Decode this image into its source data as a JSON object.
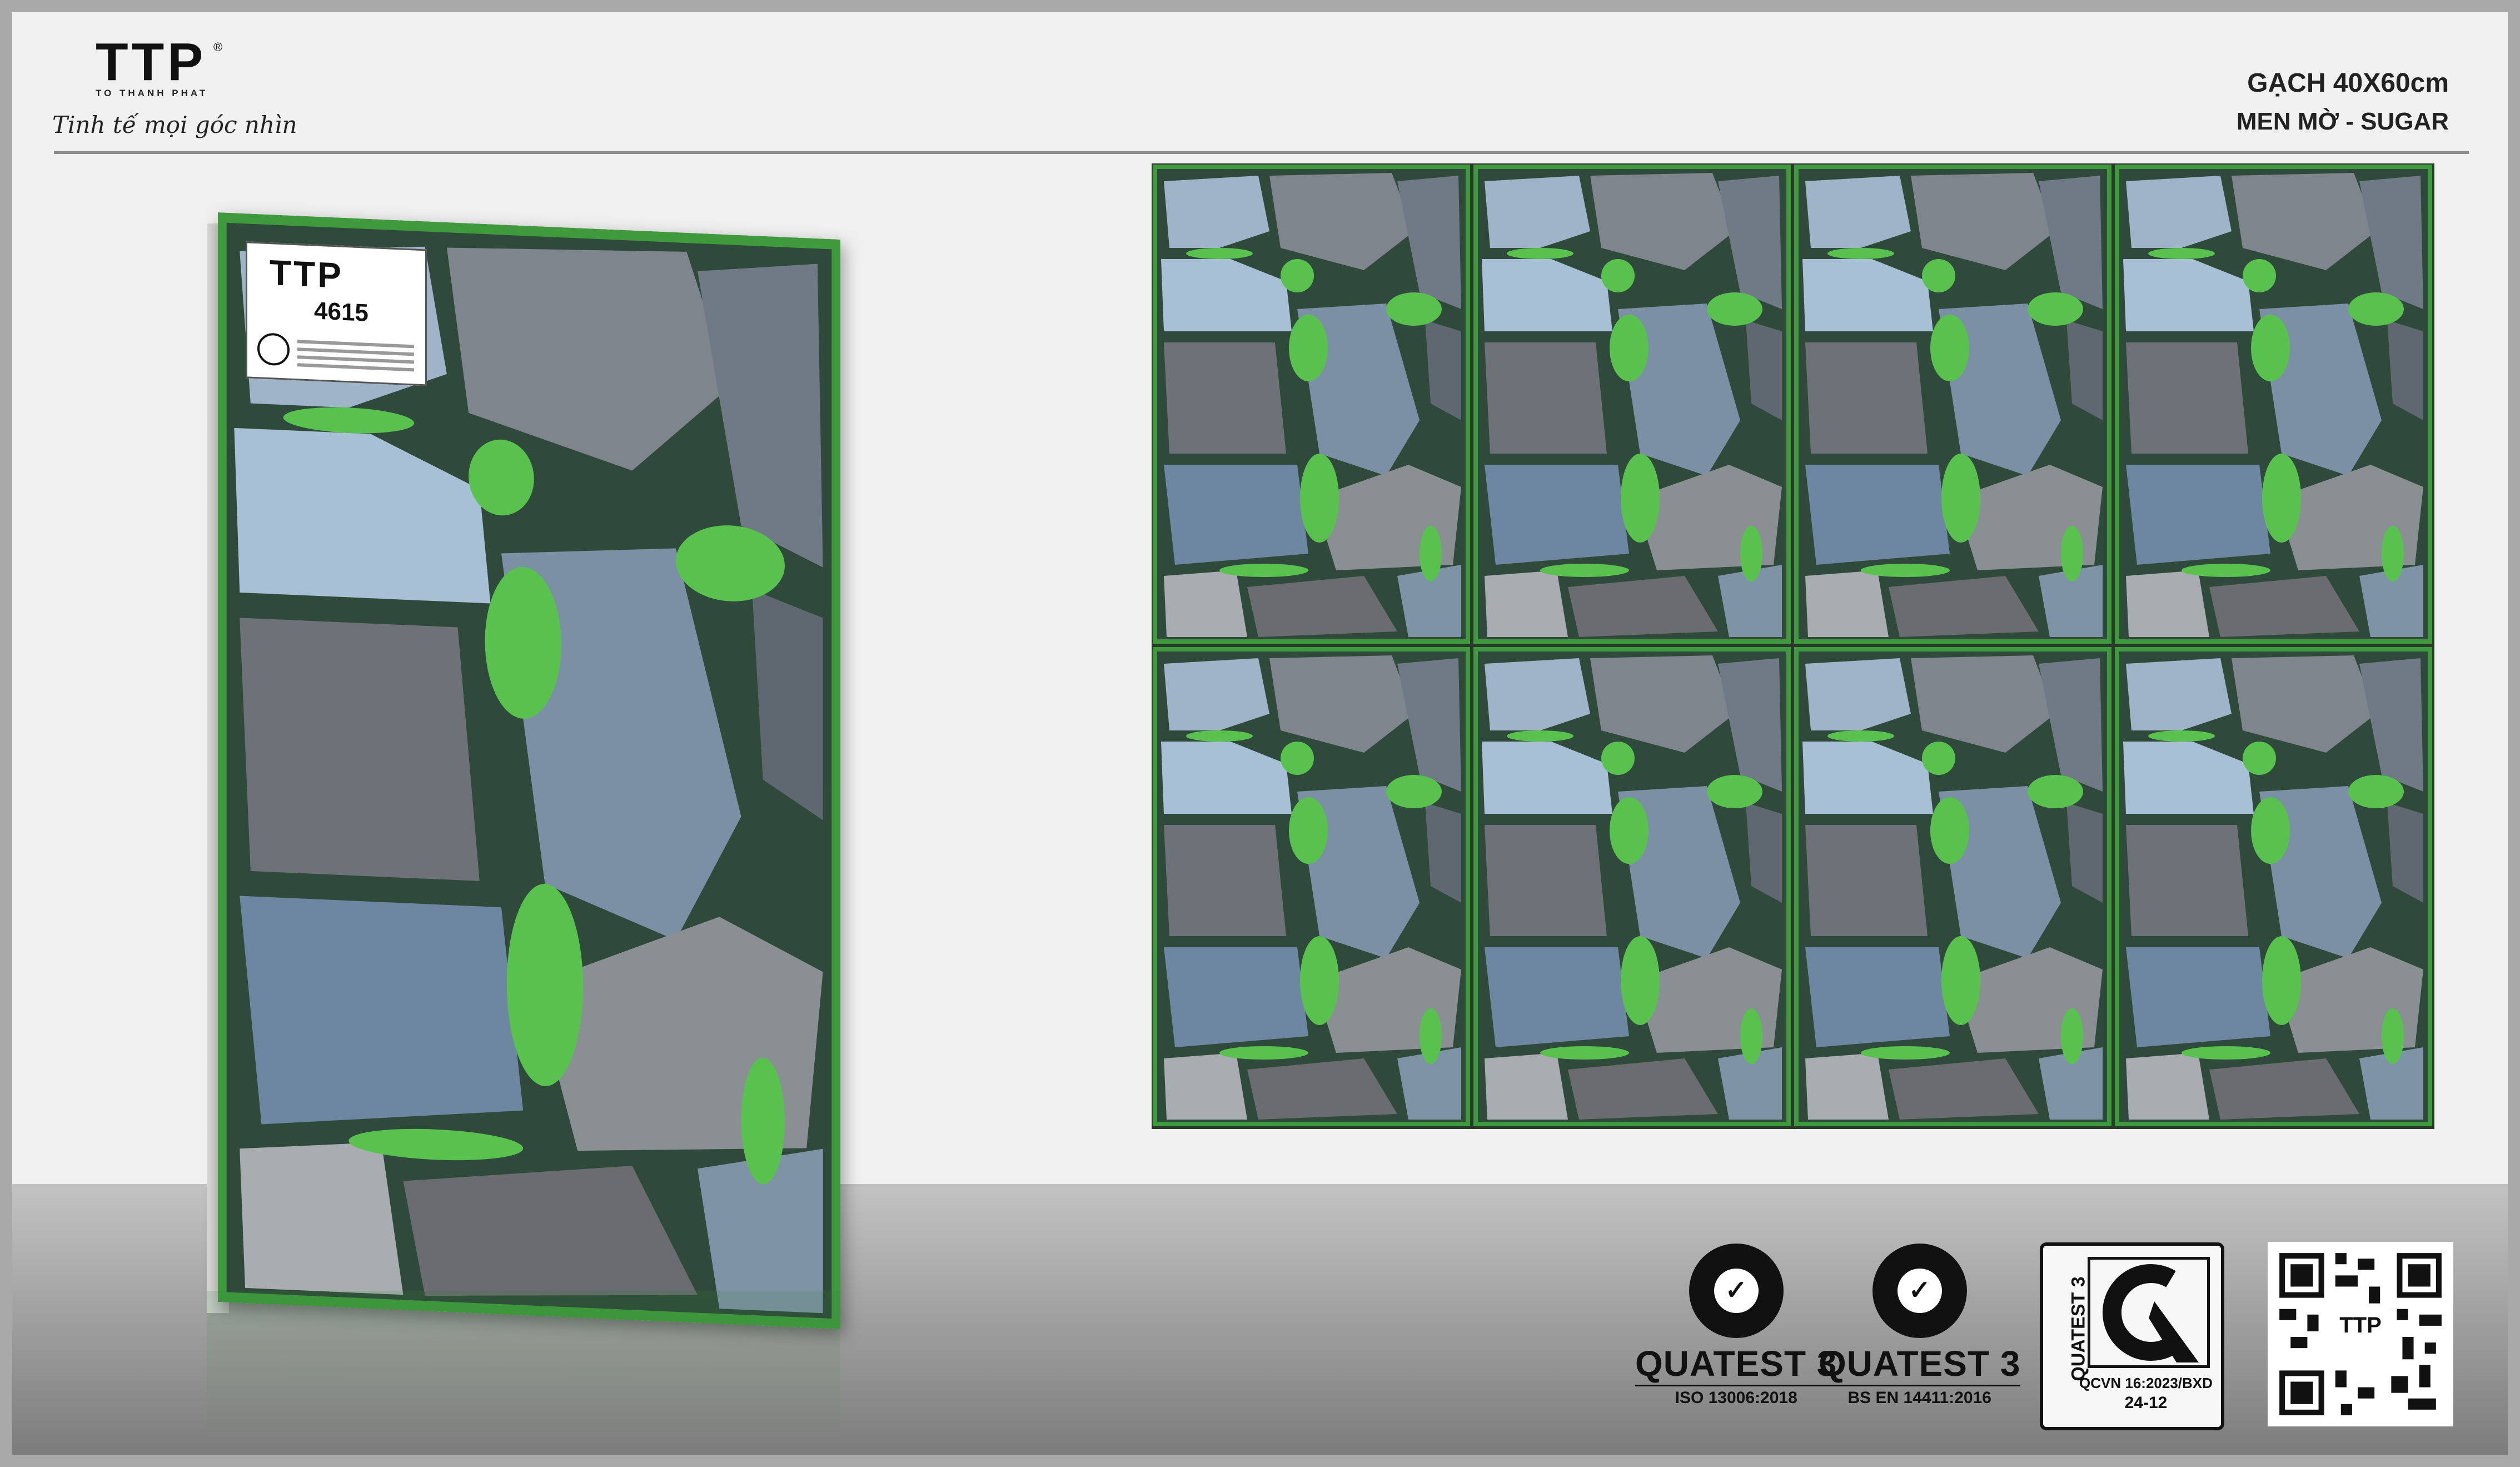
{
  "brand": {
    "logo": "TTP",
    "registered": "®",
    "company": "TO THANH PHAT",
    "slogan": "Tinh tế mọi góc nhìn"
  },
  "product": {
    "title": "GẠCH 40X60cm",
    "subtitle": "MEN MỜ - SUGAR"
  },
  "tile_label": {
    "logo": "TTP",
    "code": "4615"
  },
  "grid": {
    "rows": 2,
    "cols": 4
  },
  "certifications": [
    {
      "name": "QUATEST 3",
      "standard": "ISO 13006:2018"
    },
    {
      "name": "QUATEST 3",
      "standard": "BS EN 14411:2016"
    }
  ],
  "cr_mark": {
    "vertical": "QUATEST 3",
    "standard": "QCVN 16:2023/BXD",
    "code": "24-12"
  },
  "qr": {
    "label": "TTP"
  },
  "colors": {
    "grass": "#4caf50",
    "stone_light": "#9fb4c8",
    "stone_dark": "#6e7278",
    "background": "#f0f0f0"
  }
}
